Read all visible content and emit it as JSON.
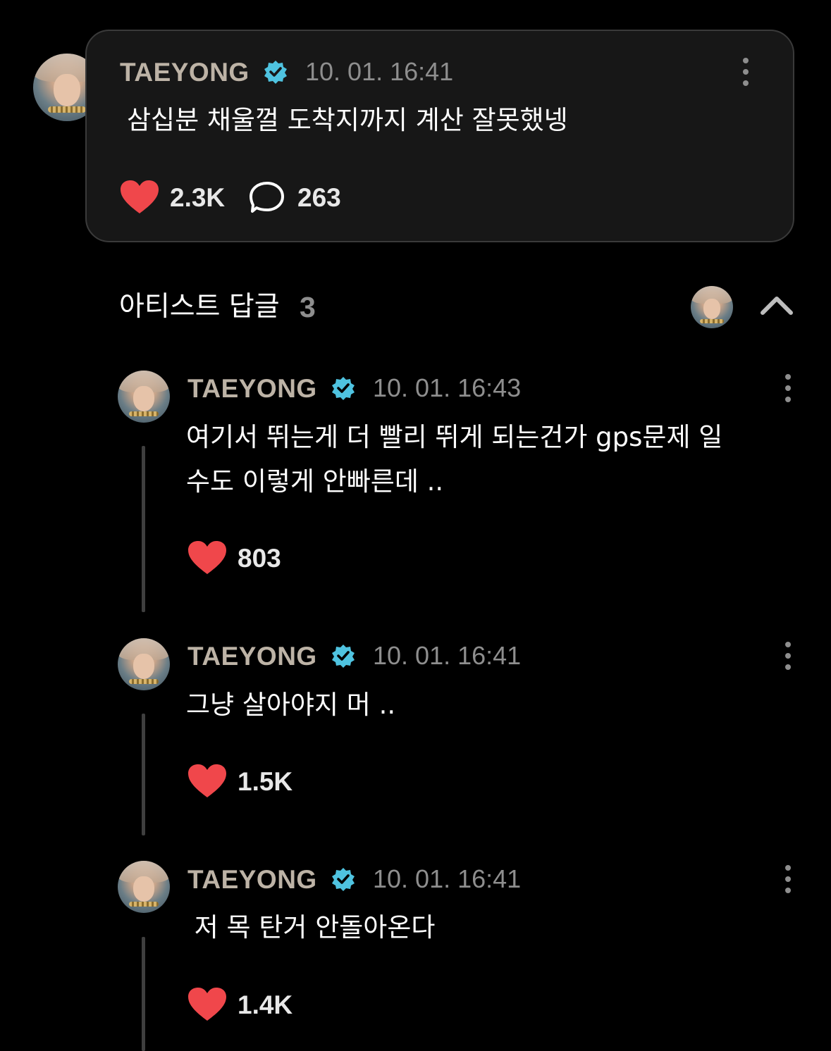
{
  "post": {
    "author": "TAEYONG",
    "verified": true,
    "timestamp": "10. 01. 16:41",
    "text": "삼십분 채울껄 도착지까지 계산 잘못했넹",
    "likes": "2.3K",
    "comments": "263"
  },
  "replies_section": {
    "title": "아티스트 답글",
    "count": "3",
    "collapse_icon": "chevron-up-icon"
  },
  "replies": [
    {
      "author": "TAEYONG",
      "timestamp": "10. 01. 16:43",
      "lines": [
        "여기서 뛰는게 더 빨리 뛰게 되는건가 gps문제 일",
        "수도 이렇게 안빠른데 .."
      ],
      "likes": "803"
    },
    {
      "author": "TAEYONG",
      "timestamp": "10. 01. 16:41",
      "lines": [
        "그냥 살아야지 머 .."
      ],
      "likes": "1.5K"
    },
    {
      "author": "TAEYONG",
      "timestamp": "10. 01. 16:41",
      "lines": [
        " 저 목 탄거 안돌아온다"
      ],
      "likes": "1.4K"
    }
  ],
  "colors": {
    "background": "#000000",
    "card": "#171717",
    "name": "#bdb3a6",
    "verified": "#4fc3e0",
    "heart": "#f0474b",
    "muted": "#8e8e8e"
  }
}
